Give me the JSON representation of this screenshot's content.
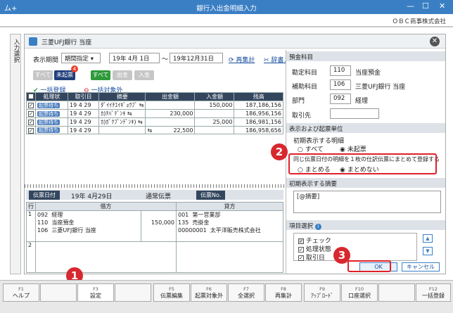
{
  "window": {
    "title": "銀行入出金明細入力",
    "company": "ＯＢＣ商事株式会社",
    "logo": "ム+"
  },
  "sidetab": {
    "label": "入力選択"
  },
  "header": {
    "bank_name": "三菱UFJ銀行 当座"
  },
  "period": {
    "label": "表示期間",
    "mode": "期間指定",
    "from": "19年 4月 1日",
    "tilde": "〜",
    "to": "19年12月31日",
    "redisplay": "再集計",
    "dictionary": "辞書メ"
  },
  "filters": {
    "all": "すべて",
    "unposted": "未起票",
    "unposted_count": "4",
    "all2": "すべて",
    "outgo": "出金",
    "income": "入金"
  },
  "bulk": {
    "register": "一括登録",
    "exclude": "一括対象外"
  },
  "table": {
    "headers": [
      "処理状",
      "取引日",
      "摘要",
      "出金額",
      "入金額",
      "残高"
    ],
    "rows": [
      {
        "status": "起票待ち",
        "date": "19  4 29",
        "summary": "ﾀﾞｲｲﾁｴｲｷﾞｮｳﾌﾞ",
        "out": "",
        "in": "150,000",
        "bal": "187,186,156"
      },
      {
        "status": "起票待ち",
        "date": "19  4 29",
        "summary": "ｶ)ﾁﾊﾞﾃﾞﾝｷ",
        "out": "230,000",
        "in": "",
        "bal": "186,956,156"
      },
      {
        "status": "起票待ち",
        "date": "19  4 29",
        "summary": "ｶ)ｶﾞｸﾌﾞﾝﾃﾞﾝｷ)",
        "out": "",
        "in": "25,000",
        "bal": "186,981,156"
      },
      {
        "status": "起票待ち",
        "date": "19  4 29",
        "summary": "",
        "out": "22,500",
        "in": "",
        "bal": "186,958,656"
      }
    ]
  },
  "slip": {
    "date_label": "伝票日付",
    "date": "19年 4月29日",
    "type": "通常伝票",
    "no_label": "伝票No.",
    "headers": {
      "row": "行",
      "debit": "借方",
      "credit": "貸方"
    },
    "line1": {
      "row": "1",
      "debit_code1": "092",
      "debit_name1": "経理",
      "debit_code2": "110",
      "debit_name2": "当座預金",
      "debit_code3": "106",
      "debit_name3": "三菱UFJ銀行 当座",
      "amount": "150,000",
      "credit_code1": "001",
      "credit_name1": "第一営業部",
      "credit_code2": "135",
      "credit_name2": "売掛金",
      "credit_code3": "00000001",
      "credit_name3": "太平洋販売株式会社"
    },
    "line2": {
      "row": "2"
    }
  },
  "right": {
    "deposit_title": "預金科目",
    "account_label": "勘定科目",
    "account_code": "110",
    "account_name": "当座預金",
    "sub_label": "補助科目",
    "sub_code": "106",
    "sub_name": "三菱UFJ銀行 当座",
    "dept_label": "部門",
    "dept_code": "092",
    "dept_name": "経理",
    "partner_label": "取引先",
    "display_title": "表示および起票単位",
    "initial_label": "初期表示する明細",
    "opt_all": "すべて",
    "opt_unposted": "未起票",
    "same_date_label": "同じ伝票日付の明細を１枚の仕訳伝票にまとめて登録する",
    "opt_merge": "まとめる",
    "opt_nomerge": "まとめない",
    "summary_title": "初期表示する摘要",
    "summary_value": "[@摘要]",
    "item_title": "項目選択",
    "items": [
      "チェック",
      "処理状態",
      "取引日"
    ],
    "ok": "OK",
    "cancel": "キャンセル"
  },
  "fkeys": [
    {
      "n": "F1",
      "l": "ヘルプ"
    },
    {
      "n": "",
      "l": ""
    },
    {
      "n": "F3",
      "l": "設定"
    },
    {
      "n": "",
      "l": ""
    },
    {
      "n": "F5",
      "l": "伝票編集"
    },
    {
      "n": "F6",
      "l": "起票対象外"
    },
    {
      "n": "F7",
      "l": "全選択"
    },
    {
      "n": "F8",
      "l": "再集計"
    },
    {
      "n": "F9",
      "l": "ｱｯﾌﾟﾛｰﾄﾞ"
    },
    {
      "n": "F10",
      "l": "口座選択"
    },
    {
      "n": "",
      "l": ""
    },
    {
      "n": "F12",
      "l": "一括登録"
    }
  ],
  "markers": [
    "1",
    "2",
    "3"
  ]
}
